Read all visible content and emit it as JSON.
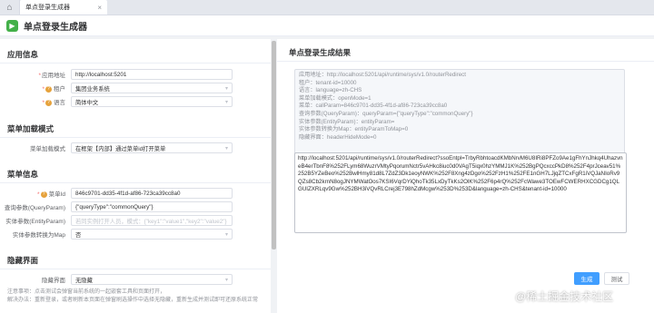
{
  "tab": {
    "label": "单点登录生成器",
    "close": "×"
  },
  "header": {
    "title": "单点登录生成器"
  },
  "left": {
    "app_section": "应用信息",
    "menu_section": "菜单加载模式",
    "menu_info_section": "菜单信息",
    "hide_section": "隐藏界面",
    "fields": {
      "app_url": {
        "label": "应用地址",
        "value": "http://localhost:5201"
      },
      "tenant": {
        "label": "租户",
        "value": "集团业务系统"
      },
      "language": {
        "label": "语言",
        "value": "简体中文"
      },
      "load_mode": {
        "label": "菜单加载模式",
        "value": "在框架【内部】通过菜单id打开菜单"
      },
      "menu_id": {
        "label": "菜单Id",
        "value": "846c9701-dd35-4f1d-af86-723ca39cc8a0"
      },
      "query_param": {
        "label": "查询参数(QueryParam)",
        "value": "{\"queryType\":\"commonQuery\"}"
      },
      "entity_param": {
        "label": "实体参数(EntityParam)",
        "placeholder": "若同实例打开人员，模式：{\"key1\":\"value1\",\"key2\":\"value2\"}"
      },
      "to_map": {
        "label": "实体参数转换为Map",
        "value": "否"
      },
      "hide_ui": {
        "label": "隐藏界面",
        "value": "无隐藏"
      }
    },
    "note": "注意事项：点击测试会弹窗当前系统的一起嵌套工具和页面打开，\n解决办法：重新登录，或者刷新本页面在弹窗刷选操作中选择无隐藏，重新生成并测试即可还原系统正常"
  },
  "right": {
    "title": "单点登录生成结果",
    "info_lines": [
      "应用地址：http://localhost:5201/api/runtime/sys/v1.0/routerRedirect",
      "租户：tenant-id=10000",
      "语言：language=zh-CHS",
      "菜单加载模式：openMode=1",
      "菜单：callParam=846c9701-dd35-4f1d-af86-723ca39cc8a0",
      "查询参数(QueryParam)：queryParam={\"queryType\":\"commonQuery\"}",
      "实体参数(EntityParam)：entityParam=",
      "实体参数转换为Map：entityParamToMap=0",
      "隐藏界面：headerHideMode=0"
    ],
    "result_text": "http://localhost:5201/api/runtime/sys/v1.0/routerRedirect?ssoEntpl=TrbyRbhtoacdKMbNrvM6U8IRi8PFZo9Ae1gFhYnJhkq4UhazvneB4erTbnF8%252FLym68WuzrVMtyPqorumNctr5vAHkc8iuc0d0VAgT5iqx0hzYMMJ1K%252BgPQcxccPkD8%252F4prJceav51%252B5YZeBeo%252BwlHmy81d8L7ZdZ3Dk1eoyNWK%252F8Xng4zDgo%252FzH1%252FE1nGH7LJjqZTCxFgR1iVQJaNIoRv9QZs8Cb2krnN8ogJNYMWatOos7KSI6VqrDYiQhoTk35LxDyTkKs2OlK%252F6p4rQ%252FcWawe3TOEwFCWERHXCGDCg1QLGUIZXRLqv9Gw%252BH3iVQvRLCrej3E798hZdMcgw%253D%253D&language=zh-CHS&tenant-id=10000",
    "generate_label": "生成",
    "test_label": "测试"
  },
  "watermark": "@稀土掘金技术社区"
}
